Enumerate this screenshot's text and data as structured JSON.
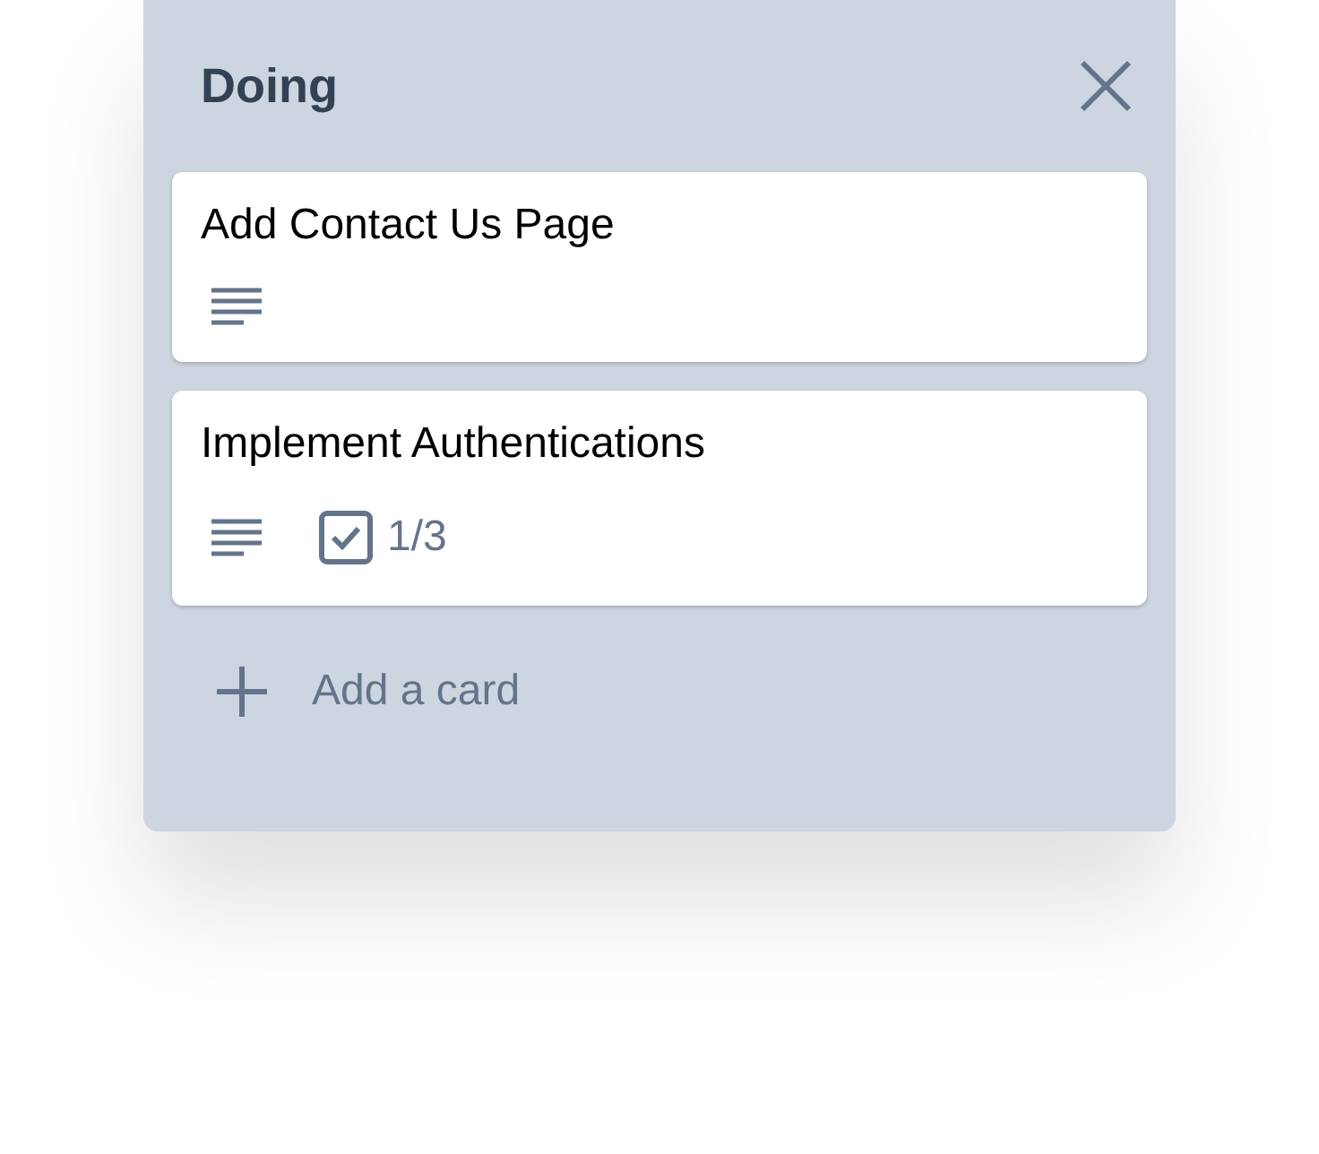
{
  "list": {
    "title": "Doing"
  },
  "cards": [
    {
      "title": "Add Contact Us Page",
      "badges": [
        {
          "kind": "description"
        }
      ]
    },
    {
      "title": "Implement Authentications",
      "badges": [
        {
          "kind": "description"
        },
        {
          "kind": "checklist",
          "text": "1/3"
        }
      ]
    }
  ],
  "add_card": {
    "label": "Add a card"
  }
}
